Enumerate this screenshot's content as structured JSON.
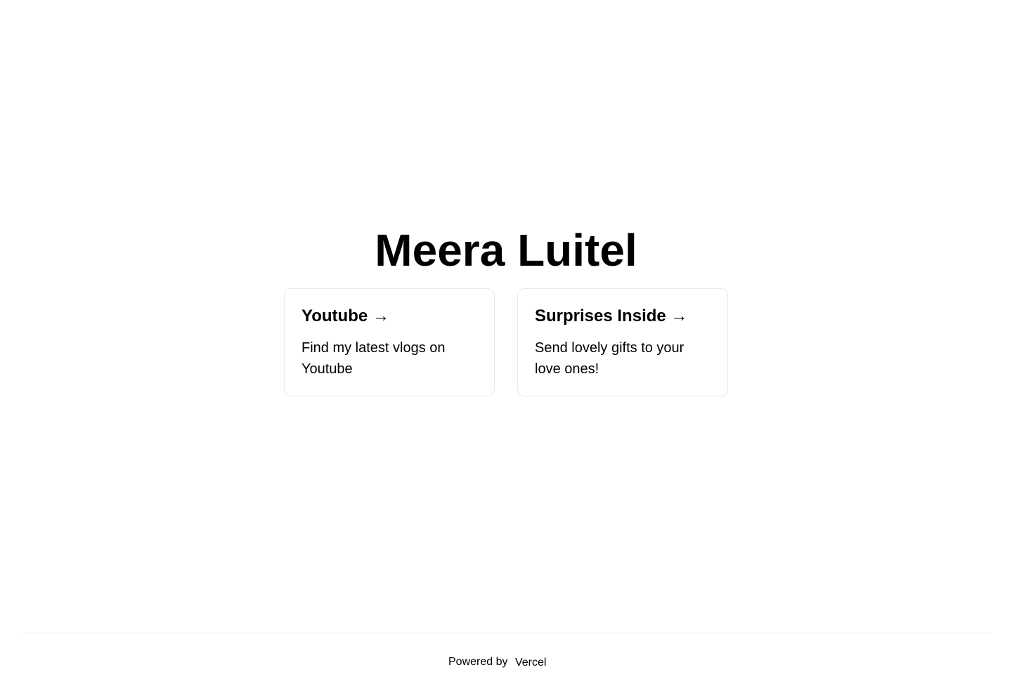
{
  "title": "Meera Luitel",
  "cards": [
    {
      "heading": "Youtube →",
      "description": "Find my latest vlogs on Youtube"
    },
    {
      "heading": "Surprises Inside →",
      "description": "Send lovely gifts to your love ones!"
    }
  ],
  "footer": {
    "powered_by": "Powered by",
    "logo_alt": "Vercel"
  },
  "colors": {
    "border": "#eaeaea",
    "text": "#000000",
    "background": "#ffffff"
  }
}
